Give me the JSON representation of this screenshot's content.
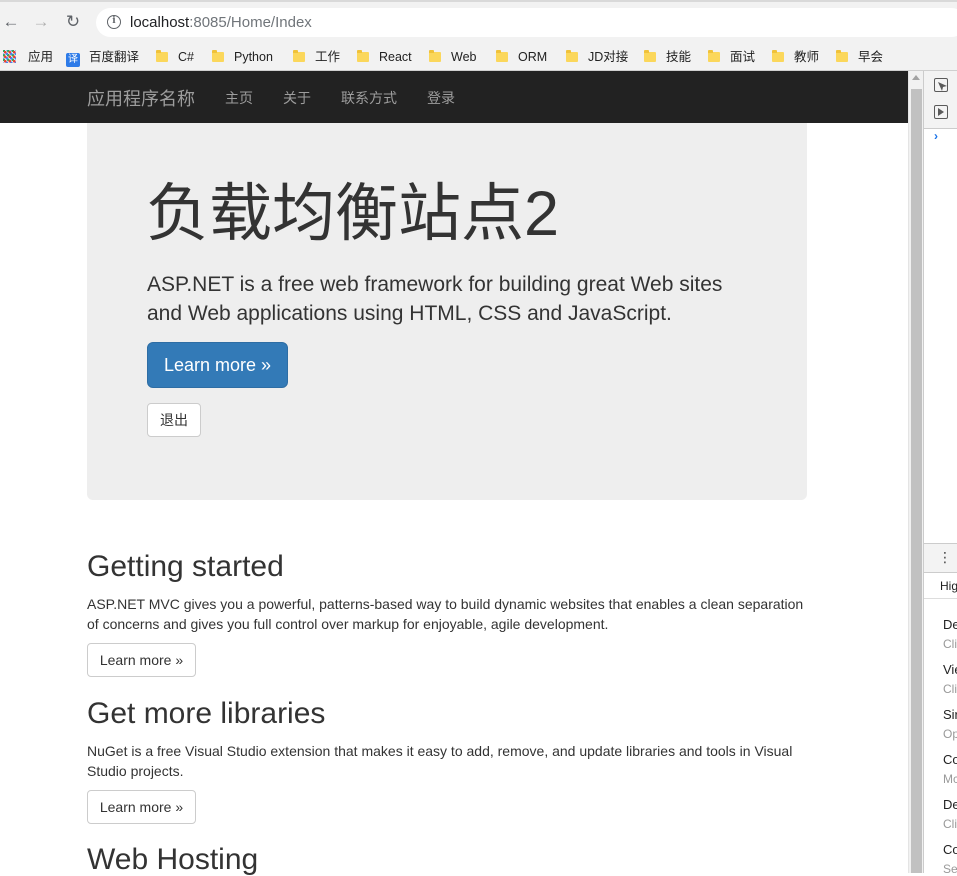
{
  "browser": {
    "url_host": "localhost",
    "url_port": ":8085",
    "url_path": "/Home/Index",
    "bookmarks": [
      "应用",
      "百度翻译",
      "C#",
      "Python",
      "工作",
      "React",
      "Web",
      "ORM",
      "JD对接",
      "技能",
      "面试",
      "教师",
      "早会"
    ]
  },
  "navbar": {
    "brand": "应用程序名称",
    "links": [
      "主页",
      "关于",
      "联系方式",
      "登录"
    ]
  },
  "jumbotron": {
    "title": "负载均衡站点2",
    "lead": "ASP.NET is a free web framework for building great Web sites and Web applications using HTML, CSS and JavaScript.",
    "learn_more": "Learn more »",
    "logout": "退出"
  },
  "sections": [
    {
      "title": "Getting started",
      "text": "ASP.NET MVC gives you a powerful, patterns-based way to build dynamic websites that enables a clean separation of concerns and gives you full control over markup for enjoyable, agile development.",
      "button": "Learn more »"
    },
    {
      "title": "Get more libraries",
      "text": "NuGet is a free Visual Studio extension that makes it easy to add, remove, and update libraries and tools in Visual Studio projects.",
      "button": "Learn more »"
    },
    {
      "title": "Web Hosting"
    }
  ],
  "devtools": {
    "chevron": "›",
    "drawer_tab": "Hig",
    "items": [
      {
        "label": "De",
        "sub": "Cli"
      },
      {
        "label": "Vie",
        "sub": "Cli"
      },
      {
        "label": "Sir",
        "sub": "Op"
      },
      {
        "label": "Co",
        "sub": "Mc"
      },
      {
        "label": "De",
        "sub": "Cli"
      },
      {
        "label": "Co",
        "sub": "Se"
      }
    ]
  },
  "colors": {
    "navbar_bg": "#222222",
    "jumbotron_bg": "#eeeeee",
    "primary": "#337ab7",
    "link_muted": "#9d9d9d"
  }
}
